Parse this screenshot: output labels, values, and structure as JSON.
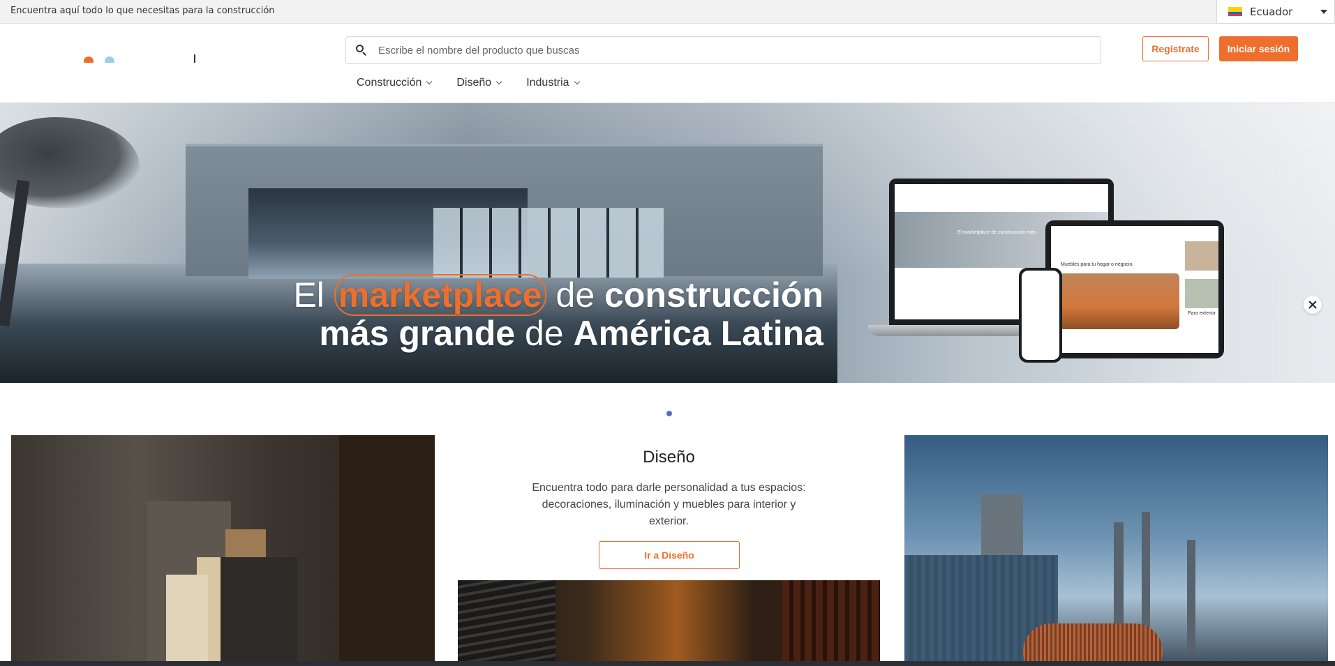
{
  "topbar": {
    "tagline": "Encuentra aquí todo lo que necesitas para la construcción",
    "country": "Ecuador"
  },
  "header": {
    "search_placeholder": "Escribe el nombre del producto que buscas",
    "register_label": "Regístrate",
    "login_label": "Iniciar sesión",
    "nav": [
      {
        "label": "Construcción"
      },
      {
        "label": "Diseño"
      },
      {
        "label": "Industria"
      }
    ]
  },
  "hero": {
    "line1_pre": "El",
    "line1_accent": "marketplace",
    "line1_mid": "de",
    "line1_bold": "construcción",
    "line2_bold1": "más grande",
    "line2_mid": "de",
    "line2_bold2": "América Latina",
    "mock_text_1": "El marketplace de construcción más",
    "mock_text_2": "Muebles para tu hogar o negocio.",
    "mock_text_3": "Para exterior"
  },
  "category": {
    "title": "Diseño",
    "description": "Encuentra todo para darle personalidad a tus espacios: decoraciones, iluminación y muebles para interior y exterior.",
    "button_label": "Ir a Diseño"
  },
  "colors": {
    "accent": "#ee6f2d",
    "indicator": "#5c6bc0"
  }
}
